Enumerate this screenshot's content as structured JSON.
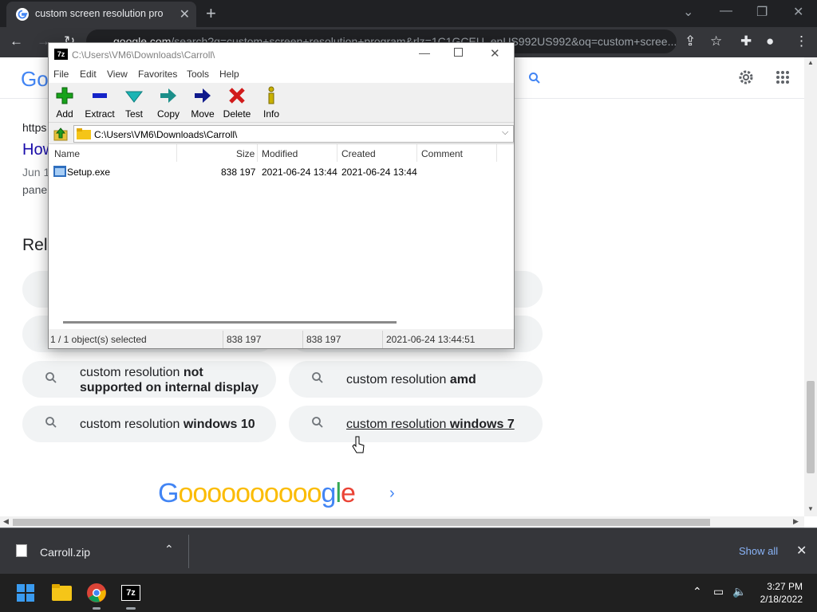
{
  "browser": {
    "tab_title": "custom screen resolution progra",
    "url_host": "google.com",
    "url_rest": "/search?q=custom+screen+resolution+program&rlz=1C1GCEU_enUS992US992&oq=custom+scree..."
  },
  "google": {
    "snippet_url": "https",
    "result_title_fragment": "How",
    "snippet_date_fragment": "Jun 1",
    "snippet_text_fragment": "pane",
    "related_heading_fragment": "Rela",
    "related": [
      {
        "normal": "custom resolution ",
        "bold": "not supported on internal display",
        "line1": "custom resolution ",
        "line1_bold": "not",
        "line2_bold": "supported on internal display"
      },
      {
        "normal": "custom resolution ",
        "bold": "amd"
      },
      {
        "normal": "custom resolution ",
        "bold": "windows 10"
      },
      {
        "normal": "custom resolution ",
        "bold": "windows 7"
      }
    ],
    "pager_logo": "Goooooooooogle"
  },
  "sevenzip": {
    "title": "C:\\Users\\VM6\\Downloads\\Carroll\\",
    "menu": [
      "File",
      "Edit",
      "View",
      "Favorites",
      "Tools",
      "Help"
    ],
    "toolbar": [
      {
        "label": "Add",
        "icon": "plus-icon",
        "color": "#17a31a"
      },
      {
        "label": "Extract",
        "icon": "minus-icon",
        "color": "#1524c8"
      },
      {
        "label": "Test",
        "icon": "check-icon",
        "color": "#1bb4b4"
      },
      {
        "label": "Copy",
        "icon": "arrow-right-icon",
        "color": "#1c8f8a"
      },
      {
        "label": "Move",
        "icon": "arrow-right-icon",
        "color": "#101a8c"
      },
      {
        "label": "Delete",
        "icon": "cross-icon",
        "color": "#d11b1b"
      },
      {
        "label": "Info",
        "icon": "info-icon",
        "color": "#c9b100"
      }
    ],
    "address": "C:\\Users\\VM6\\Downloads\\Carroll\\",
    "columns": [
      "Name",
      "Size",
      "Modified",
      "Created",
      "Comment"
    ],
    "rows": [
      {
        "name": "Setup.exe",
        "size": "838 197",
        "modified": "2021-06-24 13:44",
        "created": "2021-06-24 13:44",
        "comment": ""
      }
    ],
    "status": {
      "selected": "1 / 1 object(s) selected",
      "size": "838 197",
      "packed": "838 197",
      "date": "2021-06-24 13:44:51"
    }
  },
  "downloads": {
    "file": "Carroll.zip",
    "show_all": "Show all"
  },
  "taskbar": {
    "time": "3:27 PM",
    "date": "2/18/2022"
  }
}
